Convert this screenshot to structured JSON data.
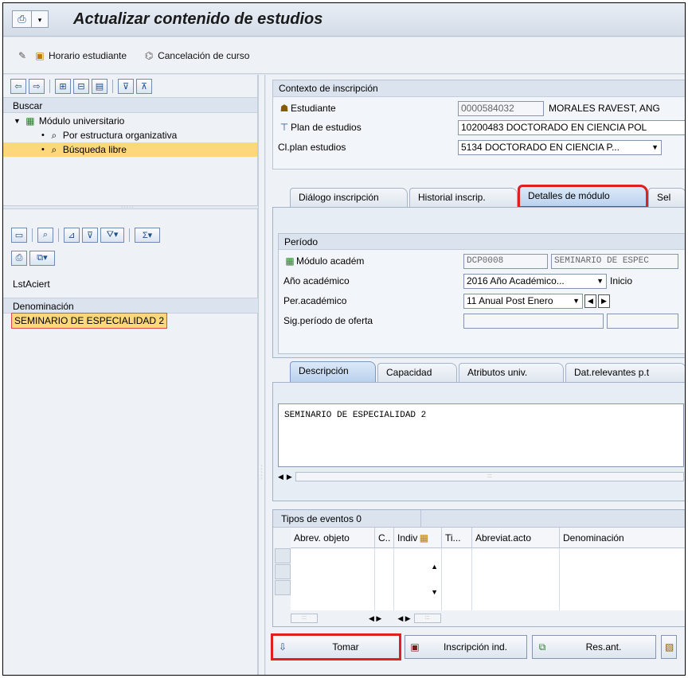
{
  "window": {
    "title": "Actualizar contenido de estudios"
  },
  "toolbar": {
    "horario_label": "Horario estudiante",
    "cancelacion_label": "Cancelación de curso"
  },
  "navigator": {
    "search_label": "Buscar",
    "tree": [
      {
        "label": "Módulo universitario"
      },
      {
        "label": "Por estructura organizativa"
      },
      {
        "label": "Búsqueda libre"
      }
    ],
    "list_title": "LstAciert",
    "list_header": "Denominación",
    "list_items": [
      "SEMINARIO DE ESPECIALIDAD 2"
    ]
  },
  "context": {
    "title": "Contexto de inscripción",
    "student_label": "Estudiante",
    "student_id": "0000584032",
    "student_name": "MORALES RAVEST, ANG",
    "plan_label": "Plan de estudios",
    "plan_value": "10200483 DOCTORADO EN CIENCIA POL",
    "clplan_label": "Cl.plan estudios",
    "clplan_value": "5134 DOCTORADO EN CIENCIA P..."
  },
  "tabs": [
    {
      "label": "Diálogo inscripción"
    },
    {
      "label": "Historial inscrip."
    },
    {
      "label": "Detalles de módulo"
    },
    {
      "label": "Sel"
    }
  ],
  "periodo": {
    "title": "Período",
    "modulo_label": "Módulo académ",
    "modulo_code": "DCP0008",
    "modulo_name": "SEMINARIO DE ESPEC",
    "anio_label": "Año académico",
    "anio_value": "2016 Año Académico...",
    "inicio_label": "Inicio",
    "per_label": "Per.académico",
    "per_value": "11 Anual Post Enero",
    "sig_label": "Sig.período de oferta"
  },
  "inner_tabs": [
    {
      "label": "Descripción"
    },
    {
      "label": "Capacidad"
    },
    {
      "label": "Atributos univ."
    },
    {
      "label": "Dat.relevantes p.t"
    }
  ],
  "description_text": "SEMINARIO DE ESPECIALIDAD 2",
  "events_table": {
    "title": "Tipos de eventos 0",
    "columns": [
      "Abrev. objeto",
      "C..",
      "Indiv",
      "Ti...",
      "Abreviat.acto",
      "Denominación"
    ]
  },
  "buttons": {
    "tomar": "Tomar",
    "inscripcion": "Inscripción ind.",
    "resant": "Res.ant."
  },
  "colors": {
    "highlight": "#e02020",
    "selected_bg": "#fcd87a"
  }
}
